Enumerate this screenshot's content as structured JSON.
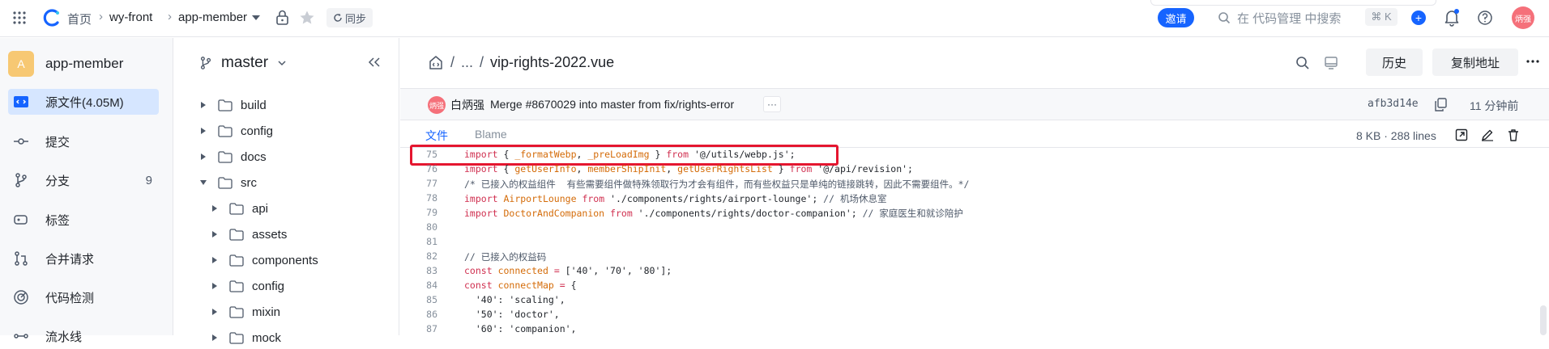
{
  "topbar": {
    "breadcrumbs": [
      "首页",
      "wy-front",
      "app-member"
    ],
    "sync_label": "同步",
    "invite_label": "邀请",
    "search_placeholder": "在 代码管理 中搜索",
    "shortcut": "⌘ K",
    "user_avatar": "炳强"
  },
  "sidebar": {
    "repo_badge": "A",
    "repo_name": "app-member",
    "items": [
      {
        "label": "源文件(4.05M)",
        "icon": "file-code-icon",
        "active": true
      },
      {
        "label": "提交",
        "icon": "commit-icon"
      },
      {
        "label": "分支",
        "icon": "branch-icon",
        "count": "9"
      },
      {
        "label": "标签",
        "icon": "tag-icon"
      },
      {
        "label": "合并请求",
        "icon": "merge-request-icon"
      },
      {
        "label": "代码检测",
        "icon": "code-scan-icon"
      },
      {
        "label": "流水线",
        "icon": "pipeline-icon"
      }
    ]
  },
  "tree": {
    "branch": "master",
    "items": [
      {
        "label": "build",
        "depth": 0,
        "open": false
      },
      {
        "label": "config",
        "depth": 0,
        "open": false
      },
      {
        "label": "docs",
        "depth": 0,
        "open": false
      },
      {
        "label": "src",
        "depth": 0,
        "open": true
      },
      {
        "label": "api",
        "depth": 1,
        "open": false
      },
      {
        "label": "assets",
        "depth": 1,
        "open": false
      },
      {
        "label": "components",
        "depth": 1,
        "open": false
      },
      {
        "label": "config",
        "depth": 1,
        "open": false
      },
      {
        "label": "mixin",
        "depth": 1,
        "open": false
      },
      {
        "label": "mock",
        "depth": 1,
        "open": false
      }
    ]
  },
  "file": {
    "path_ellipsis": "...",
    "name": "vip-rights-2022.vue",
    "history_label": "历史",
    "copy_label": "复制地址",
    "commit": {
      "author_avatar": "炳强",
      "author": "白炳强",
      "message": "Merge #8670029 into master from fix/rights-error",
      "more": "···",
      "sha": "afb3d14e",
      "time": "11 分钟前"
    },
    "tabs": [
      "文件",
      "Blame"
    ],
    "info": "8 KB · 288 lines"
  },
  "code": [
    {
      "n": "75",
      "parts": [
        [
          "kw",
          "import"
        ],
        [
          "str",
          " { "
        ],
        [
          "fn",
          "_formatWebp"
        ],
        [
          "str",
          ", "
        ],
        [
          "fn",
          "_preLoadImg"
        ],
        [
          "str",
          " } "
        ],
        [
          "kw",
          "from"
        ],
        [
          "str",
          " '@/utils/webp.js';"
        ]
      ]
    },
    {
      "n": "76",
      "parts": [
        [
          "kw",
          "import"
        ],
        [
          "str",
          " { "
        ],
        [
          "fn",
          "getUserInfo"
        ],
        [
          "str",
          ", "
        ],
        [
          "fn",
          "memberShipInit"
        ],
        [
          "str",
          ", "
        ],
        [
          "fn",
          "getUserRightsList"
        ],
        [
          "str",
          " } "
        ],
        [
          "kw",
          "from"
        ],
        [
          "str",
          " '@/api/revision';"
        ]
      ]
    },
    {
      "n": "77",
      "parts": [
        [
          "cm",
          "/* 已接入的权益组件  有些需要组件做特殊领取行为才会有组件，而有些权益只是单纯的链接跳转，因此不需要组件。*/"
        ]
      ]
    },
    {
      "n": "78",
      "parts": [
        [
          "kw",
          "import"
        ],
        [
          "str",
          " "
        ],
        [
          "fn",
          "AirportLounge"
        ],
        [
          "str",
          " "
        ],
        [
          "kw",
          "from"
        ],
        [
          "str",
          " './components/rights/airport-lounge'; "
        ],
        [
          "cm",
          "// 机场休息室"
        ]
      ]
    },
    {
      "n": "79",
      "parts": [
        [
          "kw",
          "import"
        ],
        [
          "str",
          " "
        ],
        [
          "fn",
          "DoctorAndCompanion"
        ],
        [
          "str",
          " "
        ],
        [
          "kw",
          "from"
        ],
        [
          "str",
          " './components/rights/doctor-companion'; "
        ],
        [
          "cm",
          "// 家庭医生和就诊陪护"
        ]
      ]
    },
    {
      "n": "80",
      "parts": []
    },
    {
      "n": "81",
      "parts": []
    },
    {
      "n": "82",
      "parts": [
        [
          "cm",
          "// 已接入的权益码"
        ]
      ]
    },
    {
      "n": "83",
      "parts": [
        [
          "kw",
          "const"
        ],
        [
          "str",
          " "
        ],
        [
          "fn",
          "connected"
        ],
        [
          "str",
          " "
        ],
        [
          "kw",
          "="
        ],
        [
          "str",
          " ['40', '70', '80'];"
        ]
      ]
    },
    {
      "n": "84",
      "parts": [
        [
          "kw",
          "const"
        ],
        [
          "str",
          " "
        ],
        [
          "fn",
          "connectMap"
        ],
        [
          "str",
          " "
        ],
        [
          "kw",
          "="
        ],
        [
          "str",
          " {"
        ]
      ]
    },
    {
      "n": "85",
      "parts": [
        [
          "str",
          "  '40': 'scaling',"
        ]
      ]
    },
    {
      "n": "86",
      "parts": [
        [
          "str",
          "  '50': 'doctor',"
        ]
      ]
    },
    {
      "n": "87",
      "parts": [
        [
          "str",
          "  '60': 'companion',"
        ]
      ]
    }
  ],
  "colors": {
    "accent": "#1664ff",
    "highlight": "#e5162f",
    "keyword": "#d03050",
    "identifier": "#d46b08"
  }
}
